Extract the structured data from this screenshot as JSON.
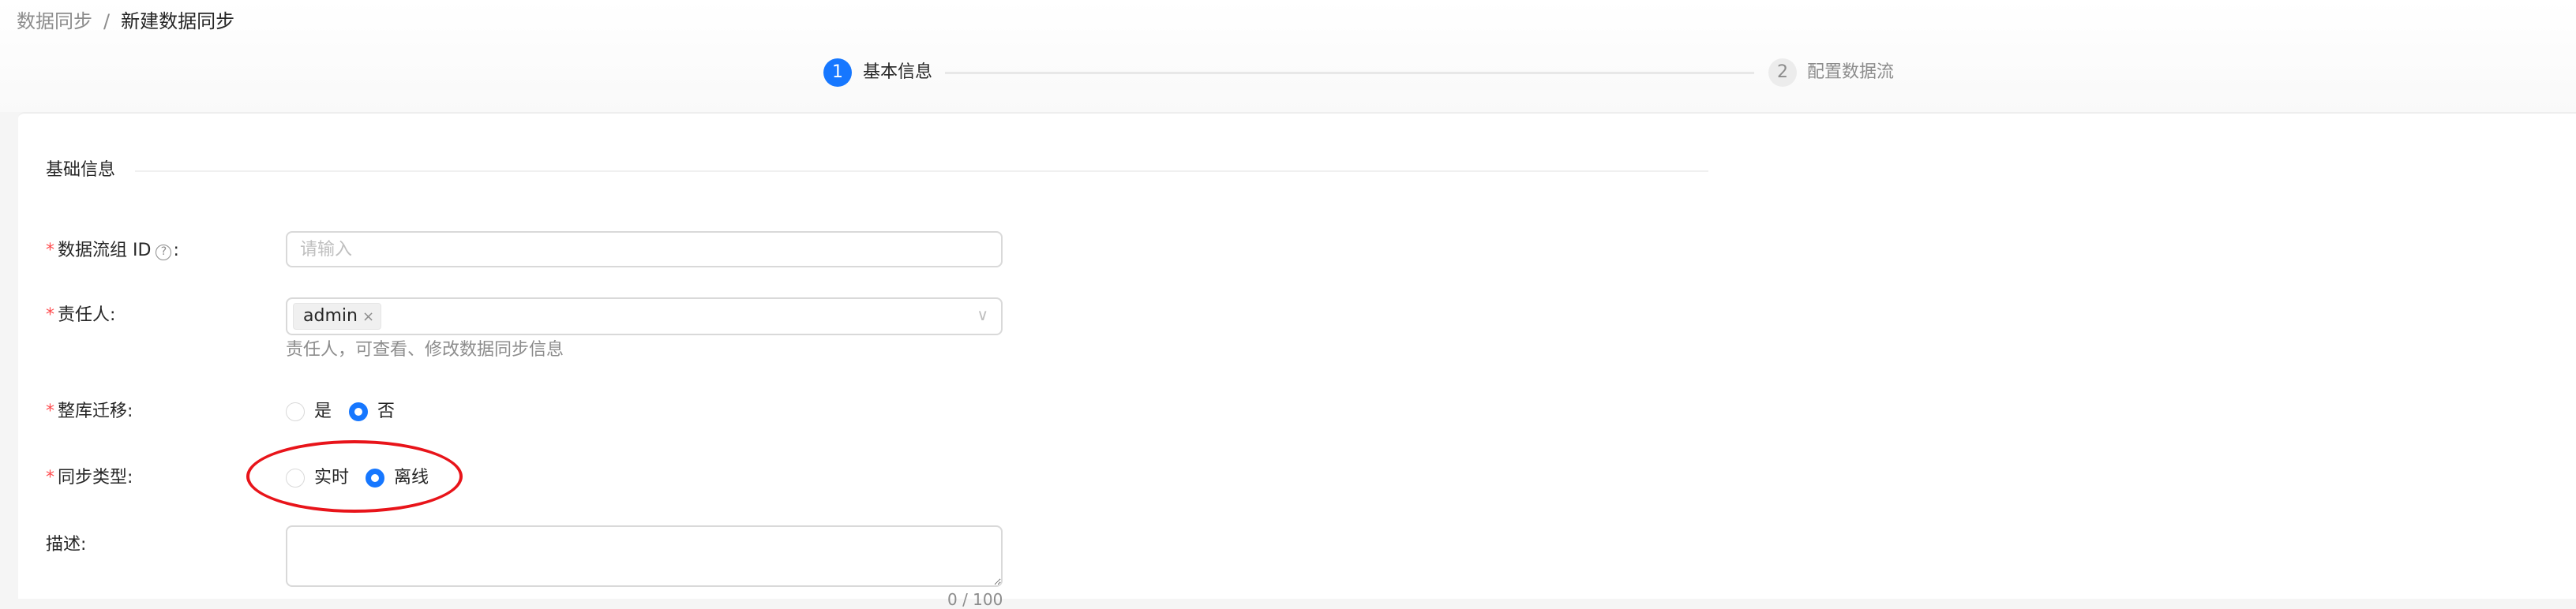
{
  "breadcrumb": {
    "parent": "数据同步",
    "separator": "/",
    "current": "新建数据同步"
  },
  "steps": [
    {
      "number": "1",
      "label": "基本信息",
      "status": "active"
    },
    {
      "number": "2",
      "label": "配置数据流",
      "status": "wait"
    }
  ],
  "section_title": "基础信息",
  "form": {
    "group_id": {
      "label": "数据流组 ID",
      "help_icon": "question-circle-icon",
      "colon": ":",
      "placeholder": "请输入",
      "value": ""
    },
    "owner": {
      "label": "责任人",
      "colon": ":",
      "tags": [
        "admin"
      ],
      "tag_remove": "×",
      "chevron": "∨",
      "hint": "责任人，可查看、修改数据同步信息"
    },
    "whole_db": {
      "label": "整库迁移",
      "colon": ":",
      "options": [
        "是",
        "否"
      ],
      "selected": "否"
    },
    "sync_type": {
      "label": "同步类型",
      "colon": ":",
      "options": [
        "实时",
        "离线"
      ],
      "selected": "离线"
    },
    "description": {
      "label": "描述",
      "colon": ":",
      "value": "",
      "counter": "0 / 100"
    }
  },
  "required_mark": "*",
  "colors": {
    "primary": "#1677ff",
    "required": "#ff4d4f",
    "annotation": "#e8141a"
  }
}
